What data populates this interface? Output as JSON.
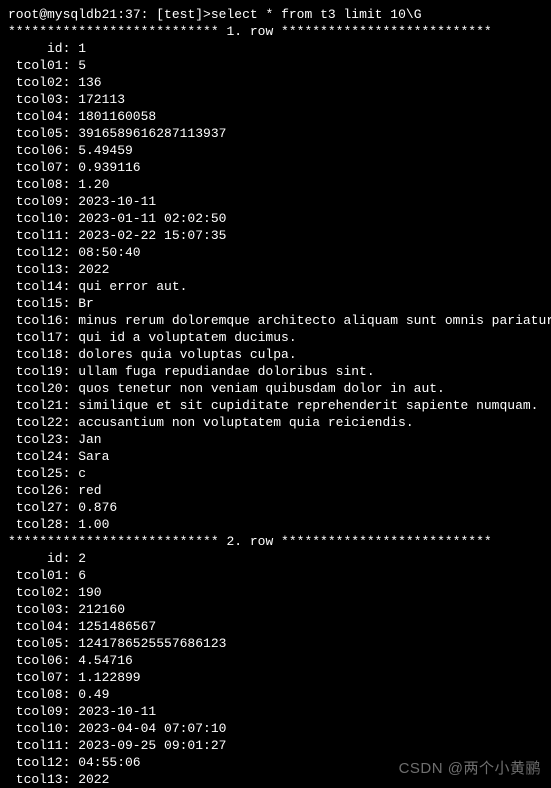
{
  "prompt": {
    "user_host": "root@mysqldb21:37:",
    "db": "[test]>",
    "command": "select * from t3 limit 10\\G"
  },
  "row_sep": {
    "stars_left": "*************************** ",
    "stars_right": " ***************************",
    "label1": "1. row",
    "label2": "2. row"
  },
  "rows": [
    {
      "id": "1",
      "tcol01": "5",
      "tcol02": "136",
      "tcol03": "172113",
      "tcol04": "1801160058",
      "tcol05": "3916589616287113937",
      "tcol06": "5.49459",
      "tcol07": "0.939116",
      "tcol08": "1.20",
      "tcol09": "2023-10-11",
      "tcol10": "2023-01-11 02:02:50",
      "tcol11": "2023-02-22 15:07:35",
      "tcol12": "08:50:40",
      "tcol13": "2022",
      "tcol14": "qui error aut.",
      "tcol15": "Br",
      "tcol16": "minus rerum doloremque architecto aliquam sunt omnis pariatur quidem.",
      "tcol17": "qui id a voluptatem ducimus.",
      "tcol18": "dolores quia voluptas culpa.",
      "tcol19": "ullam fuga repudiandae doloribus sint.",
      "tcol20": "quos tenetur non veniam quibusdam dolor in aut.",
      "tcol21": "similique et sit cupiditate reprehenderit sapiente numquam.",
      "tcol22": "accusantium non voluptatem quia reiciendis.",
      "tcol23": "Jan",
      "tcol24": "Sara",
      "tcol25": "c",
      "tcol26": "red",
      "tcol27": "0.876",
      "tcol28": "1.00"
    },
    {
      "id": "2",
      "tcol01": "6",
      "tcol02": "190",
      "tcol03": "212160",
      "tcol04": "1251486567",
      "tcol05": "1241786525557686123",
      "tcol06": "4.54716",
      "tcol07": "1.122899",
      "tcol08": "0.49",
      "tcol09": "2023-10-11",
      "tcol10": "2023-04-04 07:07:10",
      "tcol11": "2023-09-25 09:01:27",
      "tcol12": "04:55:06",
      "tcol13": "2022"
    }
  ],
  "field_order_row1": [
    "id",
    "tcol01",
    "tcol02",
    "tcol03",
    "tcol04",
    "tcol05",
    "tcol06",
    "tcol07",
    "tcol08",
    "tcol09",
    "tcol10",
    "tcol11",
    "tcol12",
    "tcol13",
    "tcol14",
    "tcol15",
    "tcol16",
    "tcol17",
    "tcol18",
    "tcol19",
    "tcol20",
    "tcol21",
    "tcol22",
    "tcol23",
    "tcol24",
    "tcol25",
    "tcol26",
    "tcol27",
    "tcol28"
  ],
  "field_order_row2": [
    "id",
    "tcol01",
    "tcol02",
    "tcol03",
    "tcol04",
    "tcol05",
    "tcol06",
    "tcol07",
    "tcol08",
    "tcol09",
    "tcol10",
    "tcol11",
    "tcol12",
    "tcol13"
  ],
  "watermark": "CSDN @两个小黄鹂"
}
